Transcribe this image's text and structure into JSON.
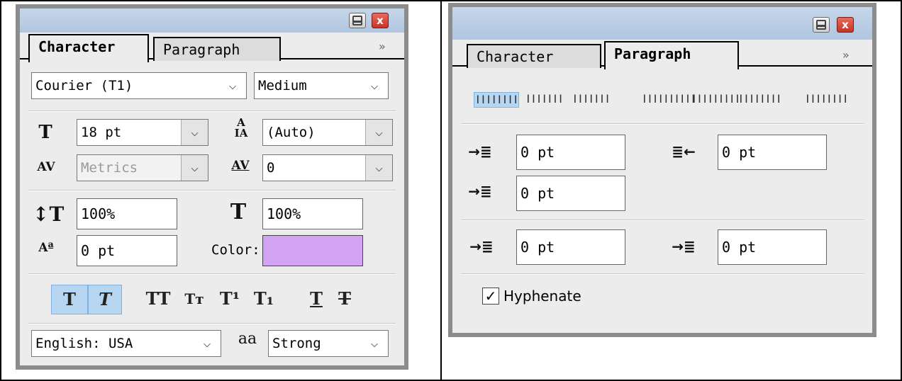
{
  "character_panel": {
    "tabs": [
      {
        "label": "Character",
        "active": true
      },
      {
        "label": "Paragraph",
        "active": false
      }
    ],
    "font_family": "Courier (T1)",
    "font_style": "Medium",
    "font_size": "18 pt",
    "leading": "(Auto)",
    "kerning": "Metrics",
    "tracking": "0",
    "vertical_scale": "100%",
    "horizontal_scale": "100%",
    "baseline_shift": "0 pt",
    "color_label": "Color:",
    "color_value": "#d2a3f2",
    "style_buttons": [
      {
        "glyph": "T",
        "name": "faux-bold",
        "active": true
      },
      {
        "glyph": "T",
        "name": "faux-italic",
        "active": true
      },
      {
        "glyph": "TT",
        "name": "all-caps",
        "active": false
      },
      {
        "glyph": "Tт",
        "name": "small-caps",
        "active": false
      },
      {
        "glyph": "T¹",
        "name": "superscript",
        "active": false
      },
      {
        "glyph": "T₁",
        "name": "subscript",
        "active": false
      },
      {
        "glyph": "T",
        "name": "underline",
        "active": false
      },
      {
        "glyph": "T",
        "name": "strikethrough",
        "active": false
      }
    ],
    "language": "English: USA",
    "antialias_icon": "aa",
    "antialias": "Strong"
  },
  "paragraph_panel": {
    "tabs": [
      {
        "label": "Character",
        "active": false
      },
      {
        "label": "Paragraph",
        "active": true
      }
    ],
    "indent_left": "0 pt",
    "indent_right": "0 pt",
    "indent_first_line": "0 pt",
    "space_before": "0 pt",
    "space_after": "0 pt",
    "hyphenate_label": "Hyphenate",
    "hyphenate_checked": true
  },
  "icons": {
    "menu_chevron": "»",
    "dropdown_arrow": "⌵",
    "close": "x",
    "check": "✓"
  }
}
